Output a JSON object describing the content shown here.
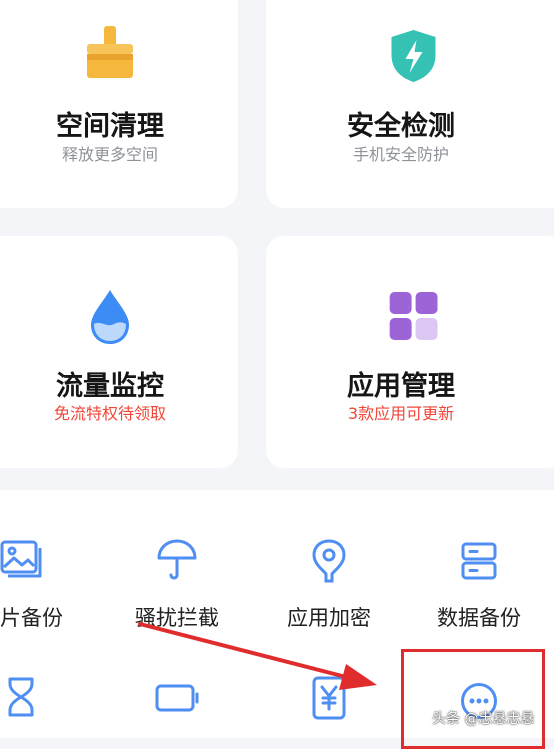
{
  "cards": [
    {
      "title": "空间清理",
      "subtitle": "释放更多空间",
      "icon": "broom-icon"
    },
    {
      "title": "安全检测",
      "subtitle": "手机安全防护",
      "icon": "shield-bolt-icon"
    },
    {
      "title": "流量监控",
      "subtitle": "免流特权待领取",
      "icon": "water-drop-icon"
    },
    {
      "title": "应用管理",
      "subtitle": "3款应用可更新",
      "icon": "grid-apps-icon"
    }
  ],
  "tools": [
    {
      "label": "照片备份",
      "icon": "photo-icon"
    },
    {
      "label": "骚扰拦截",
      "icon": "umbrella-icon"
    },
    {
      "label": "应用加密",
      "icon": "lock-pin-icon"
    },
    {
      "label": "数据备份",
      "icon": "server-icon"
    }
  ],
  "bottom_tools": [
    {
      "icon": "hourglass-icon"
    },
    {
      "icon": "battery-icon"
    },
    {
      "icon": "yuan-icon"
    },
    {
      "icon": "more-icon"
    }
  ],
  "watermark": "头条 @忠悬忠悬",
  "colors": {
    "accent_blue": "#4f8ef2",
    "warning_red": "#f0473a",
    "highlight_red": "#e02c2c",
    "broom_yellow": "#f5b73c",
    "shield_teal": "#35c2b5",
    "drop_blue": "#3d8cf5",
    "apps_purple": "#9d64d8"
  }
}
